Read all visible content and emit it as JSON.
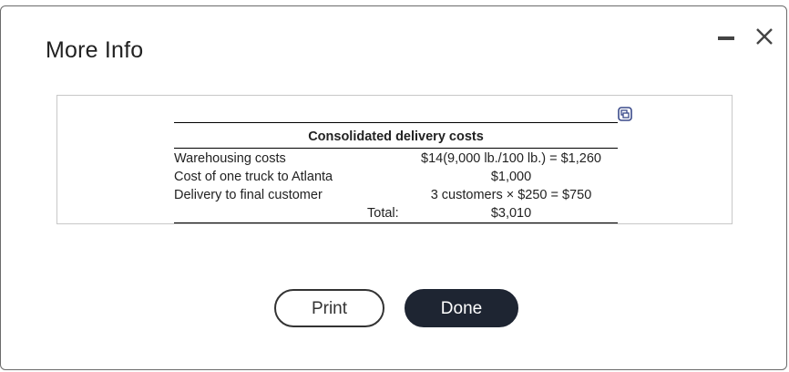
{
  "dialog": {
    "title": "More Info"
  },
  "window_controls": {
    "minimize_icon": "minus-icon",
    "close_icon": "close-icon"
  },
  "info_panel": {
    "copy_icon": "copy-icon",
    "table": {
      "title": "Consolidated delivery costs",
      "rows": [
        {
          "label": "Warehousing costs",
          "value": "$14(9,000 lb./100 lb.) = $1,260"
        },
        {
          "label": "Cost of one truck to Atlanta",
          "value": "$1,000"
        },
        {
          "label": "Delivery to final customer",
          "value": "3 customers × $250 = $750"
        }
      ],
      "total": {
        "label": "Total:",
        "value": "$3,010"
      }
    }
  },
  "buttons": {
    "print_label": "Print",
    "done_label": "Done"
  },
  "colors": {
    "done_bg": "#1e2532",
    "copy_icon_accent": "#3a4a8a"
  }
}
